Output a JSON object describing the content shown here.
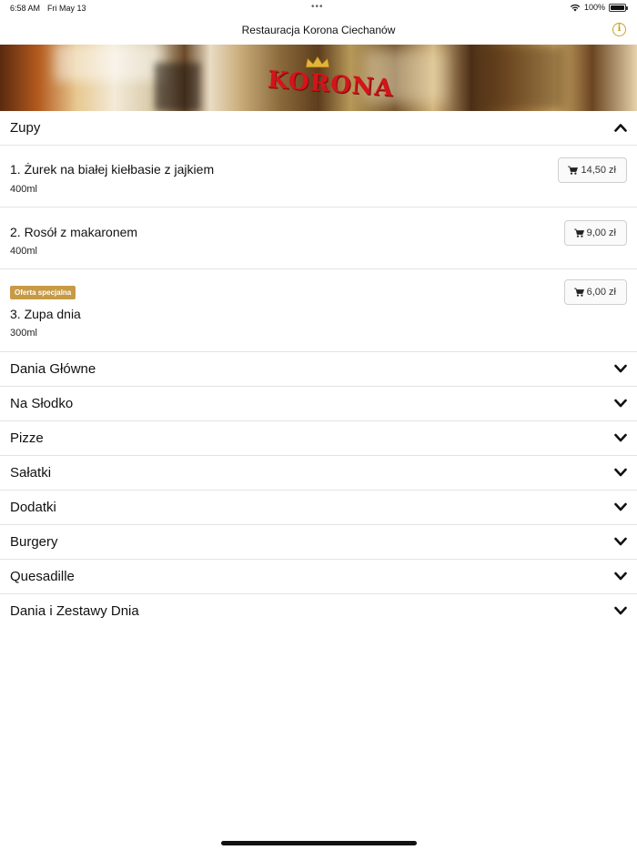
{
  "status": {
    "time": "6:58 AM",
    "date": "Fri May 13",
    "battery": "100%"
  },
  "nav": {
    "title": "Restauracja Korona Ciechanów",
    "info_icon": "info-icon"
  },
  "banner": {
    "logo_text": "KORONA"
  },
  "menu": {
    "open_category": {
      "label": "Zupy",
      "items": [
        {
          "name": "1. Żurek na białej kiełbasie z jajkiem",
          "desc": "400ml",
          "price": "14,50 zł",
          "badge": ""
        },
        {
          "name": "2. Rosół z makaronem",
          "desc": "400ml",
          "price": "9,00 zł",
          "badge": ""
        },
        {
          "name": "3. Zupa dnia",
          "desc": "300ml",
          "price": "6,00 zł",
          "badge": "Oferta specjalna"
        }
      ]
    },
    "categories": [
      {
        "label": "Dania Główne"
      },
      {
        "label": "Na Słodko"
      },
      {
        "label": "Pizze"
      },
      {
        "label": "Sałatki"
      },
      {
        "label": "Dodatki"
      },
      {
        "label": "Burgery"
      },
      {
        "label": "Quesadille"
      },
      {
        "label": "Dania i Zestawy Dnia"
      }
    ]
  },
  "colors": {
    "accent": "#c9a227",
    "badge": "#c79a46",
    "logo": "#d4141b"
  }
}
